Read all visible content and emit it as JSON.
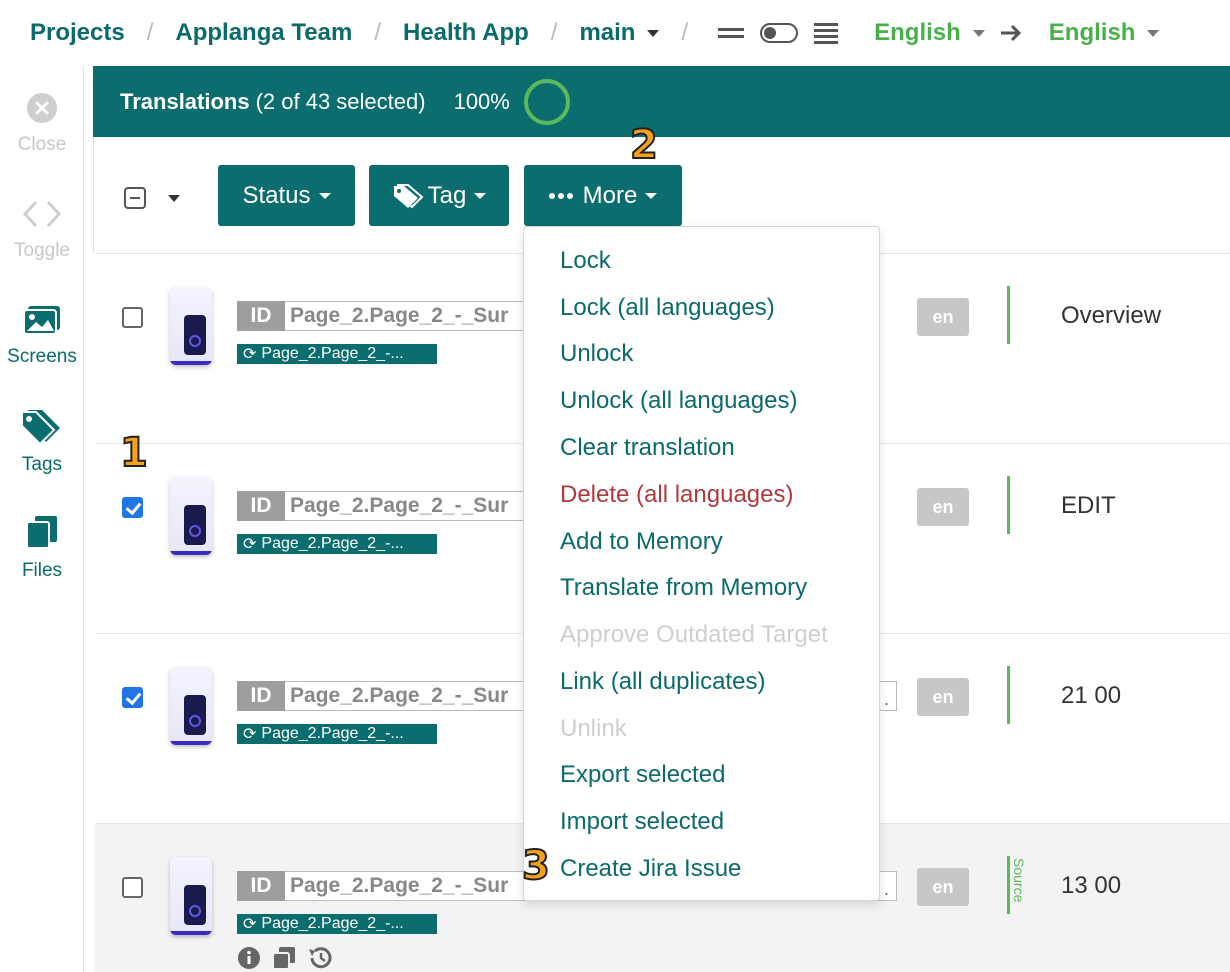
{
  "breadcrumb": {
    "projects": "Projects",
    "team": "Applanga Team",
    "app": "Health App",
    "branch": "main",
    "source_language": "English",
    "target_language": "English"
  },
  "sidebar": {
    "items": [
      {
        "label": "Close",
        "icon": "close-circle-icon",
        "state": "disabled"
      },
      {
        "label": "Toggle",
        "icon": "code-chevrons-icon",
        "state": "disabled"
      },
      {
        "label": "Screens",
        "icon": "images-icon",
        "state": "active"
      },
      {
        "label": "Tags",
        "icon": "tags-icon",
        "state": "active"
      },
      {
        "label": "Files",
        "icon": "files-icon",
        "state": "active"
      }
    ]
  },
  "header": {
    "title": "Translations",
    "selection": "(2 of 43 selected)",
    "progress": "100%"
  },
  "toolbar": {
    "status_label": "Status",
    "tag_label": "Tag",
    "more_label": "More"
  },
  "rows": [
    {
      "id_label": "ID",
      "id_value": "Page_2.Page_2_-_Sur",
      "tag": "Page_2.Page_2_-...",
      "lang": "en",
      "value": "Overview",
      "checked": false
    },
    {
      "id_label": "ID",
      "id_value": "Page_2.Page_2_-_Sur",
      "tag": "Page_2.Page_2_-...",
      "lang": "en",
      "value": "EDIT",
      "checked": true
    },
    {
      "id_label": "ID",
      "id_value": "Page_2.Page_2_-_Sur",
      "tag": "Page_2.Page_2_-...",
      "lang": "en",
      "value": "21 00",
      "checked": true
    },
    {
      "id_label": "ID",
      "id_value": "Page_2.Page_2_-_Sur",
      "tag": "Page_2.Page_2_-...",
      "lang": "en",
      "value": "13 00",
      "checked": false,
      "source_label": "Source"
    }
  ],
  "more_menu": {
    "items": [
      {
        "label": "Lock",
        "state": "normal"
      },
      {
        "label": "Lock (all languages)",
        "state": "normal"
      },
      {
        "label": "Unlock",
        "state": "normal"
      },
      {
        "label": "Unlock (all languages)",
        "state": "normal"
      },
      {
        "label": "Clear translation",
        "state": "normal"
      },
      {
        "label": "Delete (all languages)",
        "state": "danger"
      },
      {
        "label": "Add to Memory",
        "state": "normal"
      },
      {
        "label": "Translate from Memory",
        "state": "normal"
      },
      {
        "label": "Approve Outdated Target",
        "state": "disabled"
      },
      {
        "label": "Link (all duplicates)",
        "state": "normal"
      },
      {
        "label": "Unlink",
        "state": "disabled"
      },
      {
        "label": "Export selected",
        "state": "normal"
      },
      {
        "label": "Import selected",
        "state": "normal"
      },
      {
        "label": "Create Jira Issue",
        "state": "normal"
      }
    ]
  },
  "steps": {
    "one": "1",
    "two": "2",
    "three": "3"
  },
  "colors": {
    "teal": "#0b6d6d",
    "green": "#4ab04a",
    "danger": "#b0393b",
    "checkbox": "#1f74e6"
  }
}
